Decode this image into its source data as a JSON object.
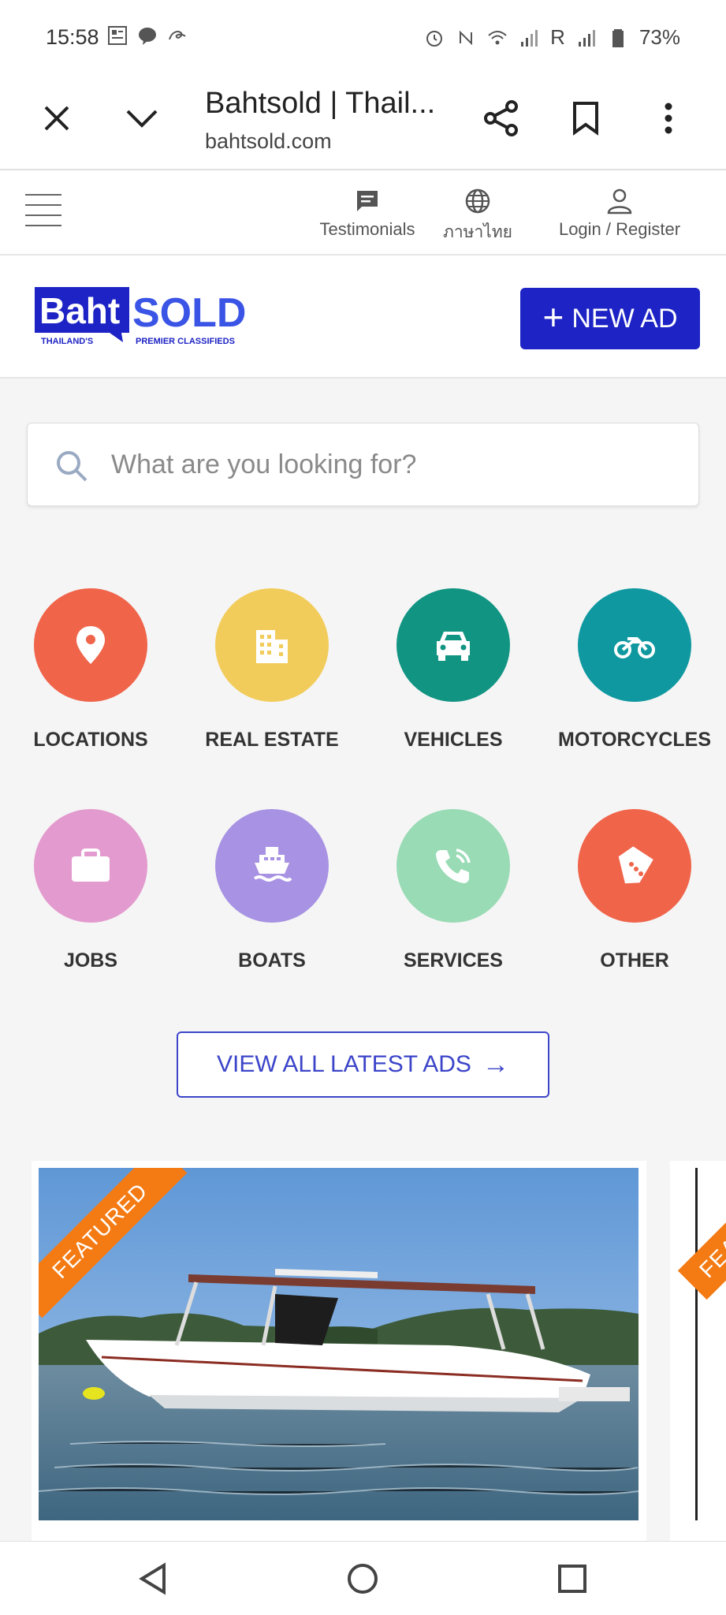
{
  "status_bar": {
    "time": "15:58",
    "battery": "73%",
    "roaming": "R",
    "icons_left": [
      "news-icon",
      "line-app-icon",
      "ink-icon"
    ],
    "icons_right": [
      "alarm-icon",
      "nfc-icon",
      "wifi-icon",
      "signal-icon",
      "signal-roaming-icon",
      "battery-icon"
    ]
  },
  "browser": {
    "title": "Bahtsold | Thail...",
    "url": "bahtsold.com",
    "buttons": [
      "close-icon",
      "chevron-down-icon",
      "share-icon",
      "bookmark-icon",
      "more-vertical-icon"
    ]
  },
  "site_nav": {
    "items": [
      {
        "label": "Testimonials",
        "icon": "chat-icon"
      },
      {
        "label": "ภาษาไทย",
        "icon": "globe-icon"
      },
      {
        "label": "Login / Register",
        "icon": "user-icon"
      }
    ]
  },
  "header": {
    "logo": {
      "part1": "Baht",
      "part2": "SOLD",
      "tag_left": "THAILAND'S",
      "tag_right": "PREMIER CLASSIFIEDS"
    },
    "new_ad_label": "NEW AD",
    "new_ad_plus": "+"
  },
  "search": {
    "placeholder": "What are you looking for?"
  },
  "categories": [
    {
      "label": "LOCATIONS",
      "icon": "location-pin-icon",
      "color": "#f0644a"
    },
    {
      "label": "REAL ESTATE",
      "icon": "building-icon",
      "color": "#f2cc5b"
    },
    {
      "label": "VEHICLES",
      "icon": "car-icon",
      "color": "#119482"
    },
    {
      "label": "MOTORCYCLES",
      "icon": "motorcycle-icon",
      "color": "#0f98a0"
    },
    {
      "label": "JOBS",
      "icon": "briefcase-icon",
      "color": "#e39ace"
    },
    {
      "label": "BOATS",
      "icon": "ship-icon",
      "color": "#a792e3"
    },
    {
      "label": "SERVICES",
      "icon": "phone-icon",
      "color": "#99dbb5"
    },
    {
      "label": "OTHER",
      "icon": "tag-icon",
      "color": "#f0644a"
    }
  ],
  "view_all": {
    "label": "VIEW ALL LATEST ADS",
    "arrow": "→"
  },
  "featured": {
    "ribbon": "FEATURED",
    "ribbon_next": "FEAT"
  },
  "colors": {
    "brand_blue": "#1d23c4",
    "accent_blue": "#3c45c9",
    "featured_orange": "#f47a13"
  }
}
